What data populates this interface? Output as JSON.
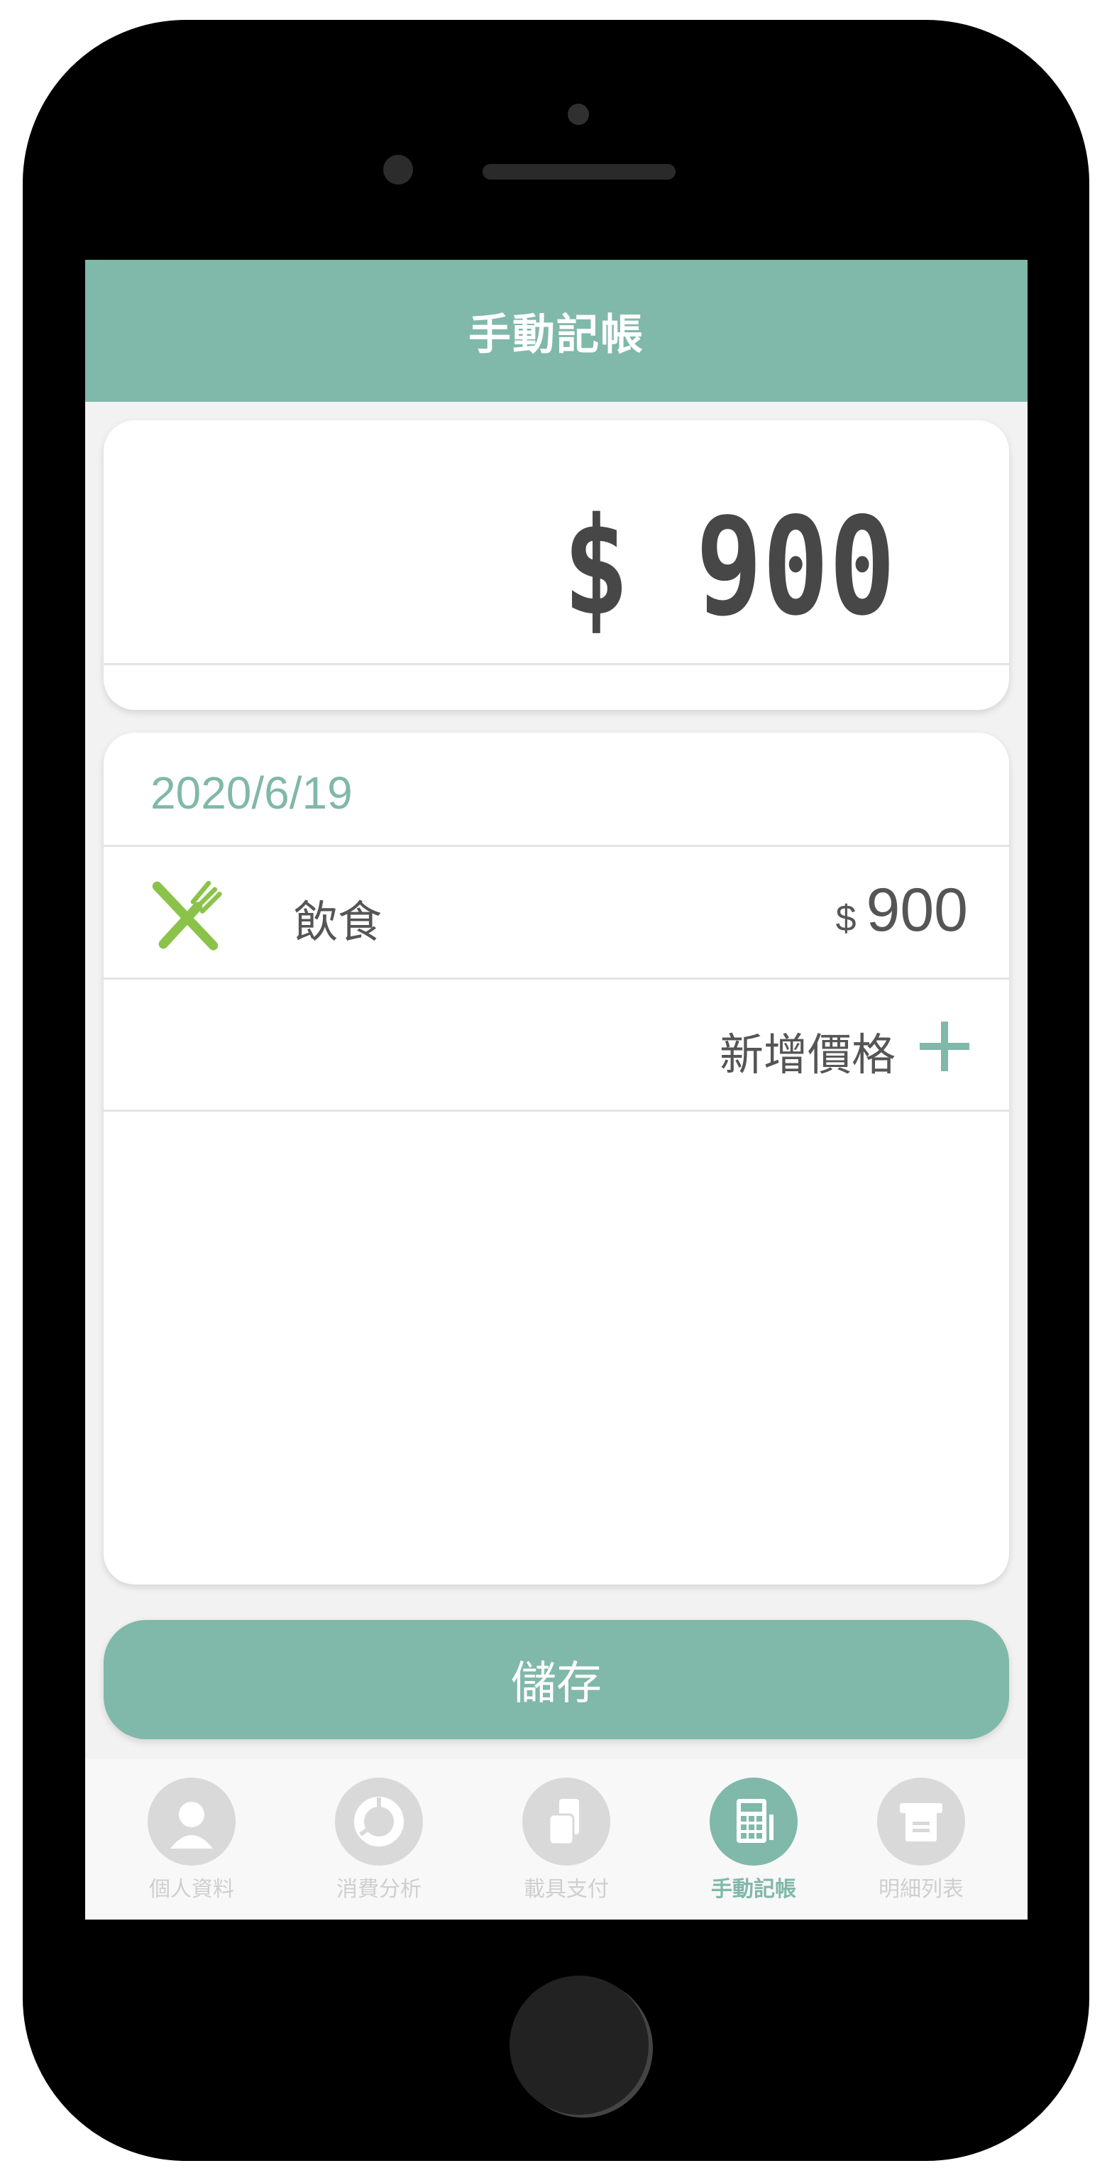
{
  "header": {
    "title": "手動記帳"
  },
  "total": {
    "display": "$ 900"
  },
  "entry": {
    "date": "2020/6/19",
    "items": [
      {
        "category": "飲食",
        "currency": "$",
        "amount": "900",
        "icon": "fork-knife-icon"
      }
    ],
    "add_label": "新增價格",
    "add_icon": "plus-icon"
  },
  "save_button": {
    "label": "儲存"
  },
  "tabs": [
    {
      "label": "個人資料",
      "icon": "person-icon",
      "active": false
    },
    {
      "label": "消費分析",
      "icon": "pie-chart-icon",
      "active": false
    },
    {
      "label": "載具支付",
      "icon": "card-payment-icon",
      "active": false
    },
    {
      "label": "手動記帳",
      "icon": "calculator-icon",
      "active": true
    },
    {
      "label": "明細列表",
      "icon": "receipt-icon",
      "active": false
    }
  ],
  "colors": {
    "accent": "#80b8a9",
    "food_icon": "#8bc34a",
    "inactive": "#d9d9d9"
  }
}
